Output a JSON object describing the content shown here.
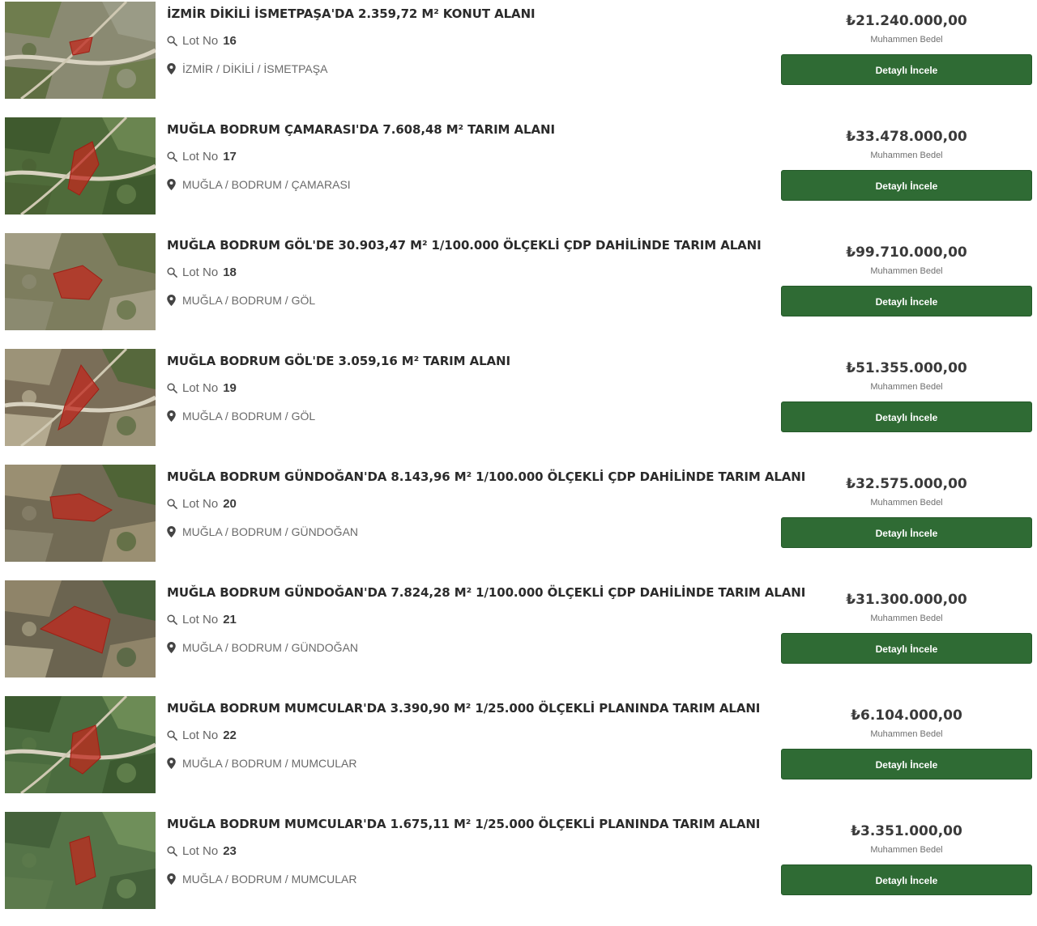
{
  "icons": {
    "lot": "search-icon",
    "location": "map-pin-icon"
  },
  "colors": {
    "button_bg": "#2f6b34",
    "button_text": "#ffffff",
    "parcel_overlay": "#c0281e"
  },
  "listings": [
    {
      "title": "İZMİR DİKİLİ İSMETPAŞA'DA 2.359,72 M² KONUT ALANI",
      "lot_label": "Lot No",
      "lot_no": "16",
      "location": "İZMİR / DİKİLİ / İSMETPAŞA",
      "price": "₺21.240.000,00",
      "price_caption": "Muhammen Bedel",
      "button_label": "Detaylı İncele"
    },
    {
      "title": "MUĞLA BODRUM ÇAMARASI'DA 7.608,48 M² TARIM ALANI",
      "lot_label": "Lot No",
      "lot_no": "17",
      "location": "MUĞLA / BODRUM / ÇAMARASI",
      "price": "₺33.478.000,00",
      "price_caption": "Muhammen Bedel",
      "button_label": "Detaylı İncele"
    },
    {
      "title": "MUĞLA BODRUM GÖL'DE 30.903,47 M² 1/100.000 ÖLÇEKLİ ÇDP DAHİLİNDE TARIM ALANI",
      "lot_label": "Lot No",
      "lot_no": "18",
      "location": "MUĞLA / BODRUM / GÖL",
      "price": "₺99.710.000,00",
      "price_caption": "Muhammen Bedel",
      "button_label": "Detaylı İncele"
    },
    {
      "title": "MUĞLA BODRUM GÖL'DE 3.059,16 M² TARIM ALANI",
      "lot_label": "Lot No",
      "lot_no": "19",
      "location": "MUĞLA / BODRUM / GÖL",
      "price": "₺51.355.000,00",
      "price_caption": "Muhammen Bedel",
      "button_label": "Detaylı İncele"
    },
    {
      "title": "MUĞLA BODRUM GÜNDOĞAN'DA 8.143,96 M² 1/100.000 ÖLÇEKLİ ÇDP DAHİLİNDE TARIM ALANI",
      "lot_label": "Lot No",
      "lot_no": "20",
      "location": "MUĞLA / BODRUM / GÜNDOĞAN",
      "price": "₺32.575.000,00",
      "price_caption": "Muhammen Bedel",
      "button_label": "Detaylı İncele"
    },
    {
      "title": "MUĞLA BODRUM GÜNDOĞAN'DA 7.824,28 M² 1/100.000 ÖLÇEKLİ ÇDP DAHİLİNDE TARIM ALANI",
      "lot_label": "Lot No",
      "lot_no": "21",
      "location": "MUĞLA / BODRUM / GÜNDOĞAN",
      "price": "₺31.300.000,00",
      "price_caption": "Muhammen Bedel",
      "button_label": "Detaylı İncele"
    },
    {
      "title": "MUĞLA BODRUM MUMCULAR'DA 3.390,90 M² 1/25.000 ÖLÇEKLİ PLANINDA TARIM ALANI",
      "lot_label": "Lot No",
      "lot_no": "22",
      "location": "MUĞLA / BODRUM / MUMCULAR",
      "price": "₺6.104.000,00",
      "price_caption": "Muhammen Bedel",
      "button_label": "Detaylı İncele"
    },
    {
      "title": "MUĞLA BODRUM MUMCULAR'DA 1.675,11 M² 1/25.000 ÖLÇEKLİ PLANINDA TARIM ALANI",
      "lot_label": "Lot No",
      "lot_no": "23",
      "location": "MUĞLA / BODRUM / MUMCULAR",
      "price": "₺3.351.000,00",
      "price_caption": "Muhammen Bedel",
      "button_label": "Detaylı İncele"
    }
  ]
}
